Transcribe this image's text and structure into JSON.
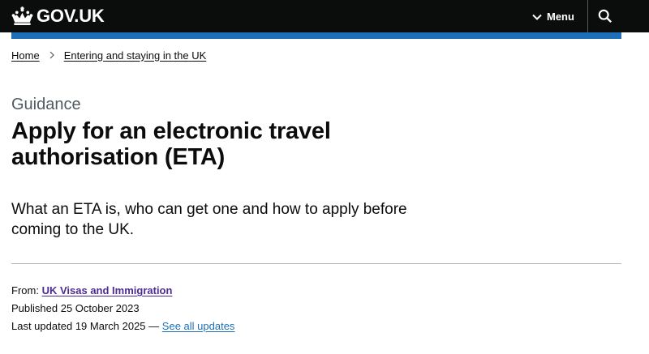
{
  "header": {
    "logo_text": "GOV.UK",
    "logo_icon": "crown-icon",
    "menu_label": "Menu",
    "menu_icon": "chevron-down-icon",
    "search_icon": "search-icon",
    "background_color": "#0b0c0c",
    "accent_bar_color": "#1d70b8"
  },
  "breadcrumb": {
    "items": [
      {
        "label": "Home"
      },
      {
        "label": "Entering and staying in the UK"
      }
    ],
    "separator_icon": "chevron-right-icon"
  },
  "page": {
    "caption": "Guidance",
    "title": "Apply for an electronic travel authorisation (ETA)",
    "lede": "What an ETA is, who can get one and how to apply before coming to the UK."
  },
  "metadata": {
    "from_label": "From:",
    "from_org": "UK Visas and Immigration",
    "published_label": "Published",
    "published_date": "25 October 2023",
    "updated_label": "Last updated",
    "updated_date": "19 March 2025",
    "updated_dash": "—",
    "see_updates_link": "See all updates",
    "org_link_color": "#4c2c92",
    "link_color": "#1d70b8"
  }
}
